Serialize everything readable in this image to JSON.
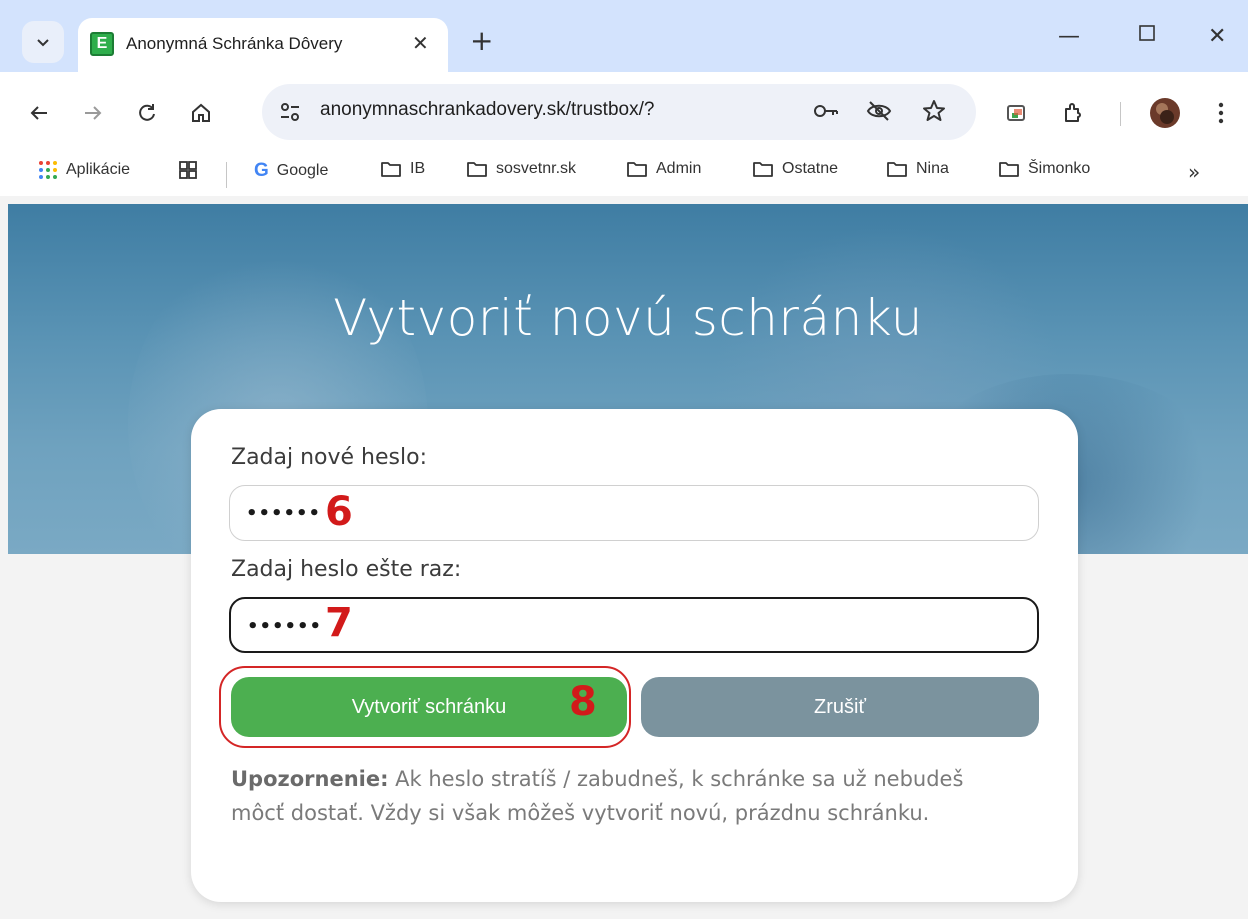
{
  "browser": {
    "tab": {
      "favicon_letter": "E",
      "title": "Anonymná Schránka Dôvery"
    },
    "omnibox": {
      "url": "anonymnaschrankadovery.sk/trustbox/?"
    },
    "bookmarks": [
      {
        "label": "Aplikácie"
      },
      {
        "label": "Google"
      },
      {
        "label": "IB"
      },
      {
        "label": "sosvetnr.sk"
      },
      {
        "label": "Admin"
      },
      {
        "label": "Ostatne"
      },
      {
        "label": "Nina"
      },
      {
        "label": "Šimonko"
      }
    ]
  },
  "page": {
    "title": "Vytvoriť novú schránku",
    "form": {
      "password_label": "Zadaj nové heslo:",
      "password_value": "••••••",
      "password_repeat_label": "Zadaj heslo ešte raz:",
      "password_repeat_value": "••••••",
      "create_button": "Vytvoriť schránku",
      "cancel_button": "Zrušiť"
    },
    "warning": {
      "bold": "Upozornenie:",
      "text": " Ak heslo stratíš / zabudneš, k schránke sa už nebudeš môcť dostať. Vždy si však môžeš vytvoriť novú, prázdnu schránku."
    },
    "annotations": {
      "step_6": "6",
      "step_7": "7",
      "step_8": "8"
    }
  },
  "colors": {
    "accent_green": "#4caf50",
    "cancel_gray": "#7b939e",
    "annotation_red": "#d21a1a",
    "tabstrip": "#d3e3fd"
  }
}
